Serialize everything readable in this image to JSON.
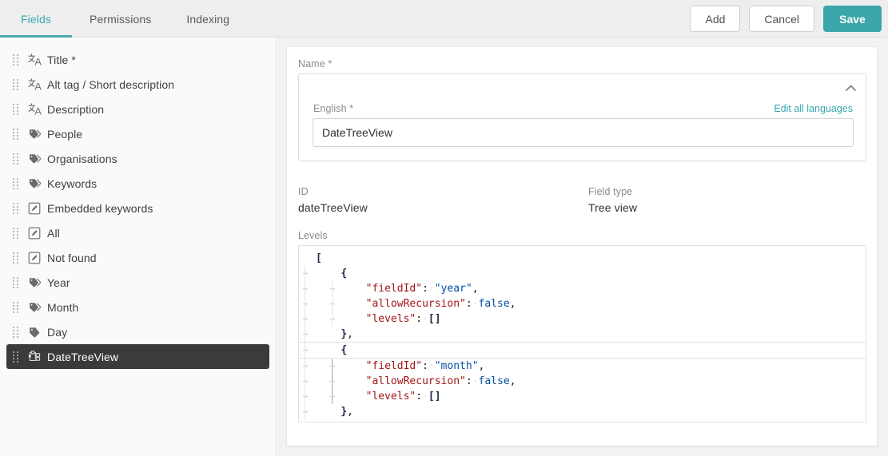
{
  "topbar": {
    "tabs": [
      {
        "label": "Fields",
        "active": true
      },
      {
        "label": "Permissions",
        "active": false
      },
      {
        "label": "Indexing",
        "active": false
      }
    ],
    "buttons": {
      "add": "Add",
      "cancel": "Cancel",
      "save": "Save"
    },
    "accent_color": "#3ba6ab"
  },
  "sidebar": {
    "items": [
      {
        "label": "Title *",
        "icon": "translate-icon",
        "selected": false
      },
      {
        "label": "Alt tag / Short description",
        "icon": "translate-icon",
        "selected": false
      },
      {
        "label": "Description",
        "icon": "translate-icon",
        "selected": false
      },
      {
        "label": "People",
        "icon": "tags-icon",
        "selected": false
      },
      {
        "label": "Organisations",
        "icon": "tags-icon",
        "selected": false
      },
      {
        "label": "Keywords",
        "icon": "tags-icon",
        "selected": false
      },
      {
        "label": "Embedded keywords",
        "icon": "edit-box-icon",
        "selected": false
      },
      {
        "label": "All",
        "icon": "edit-box-icon",
        "selected": false
      },
      {
        "label": "Not found",
        "icon": "edit-box-icon",
        "selected": false
      },
      {
        "label": "Year",
        "icon": "tags-icon",
        "selected": false
      },
      {
        "label": "Month",
        "icon": "tags-icon",
        "selected": false
      },
      {
        "label": "Day",
        "icon": "tag-icon",
        "selected": false
      },
      {
        "label": "DateTreeView",
        "icon": "tree-view-icon",
        "selected": true
      }
    ]
  },
  "detail": {
    "name_label": "Name *",
    "language_label": "English *",
    "edit_all_languages": "Edit all languages",
    "name_value": "DateTreeView",
    "name_placeholder": "",
    "id_label": "ID",
    "id_value": "dateTreeView",
    "field_type_label": "Field type",
    "field_type_value": "Tree view",
    "levels_label": "Levels",
    "levels_code": [
      {
        "indent": 0,
        "text": "[",
        "active": false
      },
      {
        "indent": 1,
        "text": "{",
        "active": false
      },
      {
        "indent": 2,
        "text": "\"fieldId\": \"year\",",
        "active": false
      },
      {
        "indent": 2,
        "text": "\"allowRecursion\": false,",
        "active": false
      },
      {
        "indent": 2,
        "text": "\"levels\": []",
        "active": false
      },
      {
        "indent": 1,
        "text": "},",
        "active": false
      },
      {
        "indent": 1,
        "text": "{",
        "active": true
      },
      {
        "indent": 2,
        "text": "\"fieldId\": \"month\",",
        "active": false
      },
      {
        "indent": 2,
        "text": "\"allowRecursion\": false,",
        "active": false
      },
      {
        "indent": 2,
        "text": "\"levels\": []",
        "active": false
      },
      {
        "indent": 1,
        "text": "},",
        "active": false
      }
    ]
  }
}
